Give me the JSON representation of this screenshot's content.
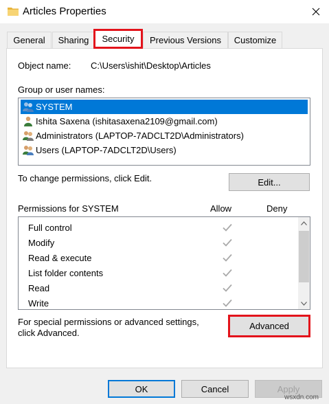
{
  "window": {
    "title": "Articles Properties"
  },
  "tabs": [
    {
      "label": "General"
    },
    {
      "label": "Sharing"
    },
    {
      "label": "Security",
      "selected": true
    },
    {
      "label": "Previous Versions"
    },
    {
      "label": "Customize"
    }
  ],
  "object": {
    "label": "Object name:",
    "value": "C:\\Users\\ishit\\Desktop\\Articles"
  },
  "groups": {
    "label": "Group or user names:",
    "items": [
      {
        "label": "SYSTEM",
        "icon": "users-group-icon",
        "selected": true
      },
      {
        "label": "Ishita Saxena (ishitasaxena2109@gmail.com)",
        "icon": "user-icon"
      },
      {
        "label": "Administrators (LAPTOP-7ADCLT2D\\Administrators)",
        "icon": "users-group-icon"
      },
      {
        "label": "Users (LAPTOP-7ADCLT2D\\Users)",
        "icon": "users-group-icon"
      }
    ]
  },
  "edit": {
    "hint": "To change permissions, click Edit.",
    "button": "Edit..."
  },
  "permissions": {
    "title": "Permissions for SYSTEM",
    "allow_header": "Allow",
    "deny_header": "Deny",
    "rows": [
      {
        "label": "Full control",
        "allow": true,
        "deny": false
      },
      {
        "label": "Modify",
        "allow": true,
        "deny": false
      },
      {
        "label": "Read & execute",
        "allow": true,
        "deny": false
      },
      {
        "label": "List folder contents",
        "allow": true,
        "deny": false
      },
      {
        "label": "Read",
        "allow": true,
        "deny": false
      },
      {
        "label": "Write",
        "allow": true,
        "deny": false
      }
    ]
  },
  "advanced": {
    "hint_line1": "For special permissions or advanced settings,",
    "hint_line2": "click Advanced.",
    "button": "Advanced"
  },
  "footer": {
    "ok": "OK",
    "cancel": "Cancel",
    "apply": "Apply"
  },
  "watermark": "wsxdn.com",
  "colors": {
    "highlight_border": "#e3131b",
    "selection": "#0078d7"
  }
}
